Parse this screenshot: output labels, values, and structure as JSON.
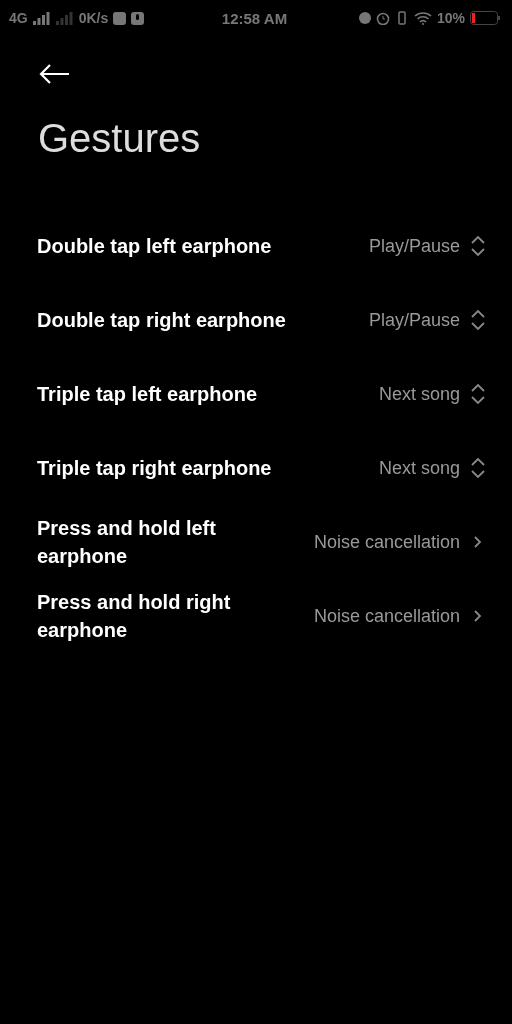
{
  "status_bar": {
    "network": "4G",
    "speed": "0K/s",
    "time": "12:58 AM",
    "battery": "10%"
  },
  "title": "Gestures",
  "rows": [
    {
      "label": "Double tap left earphone",
      "value": "Play/Pause",
      "kind": "select"
    },
    {
      "label": "Double tap right earphone",
      "value": "Play/Pause",
      "kind": "select"
    },
    {
      "label": "Triple tap left earphone",
      "value": "Next song",
      "kind": "select"
    },
    {
      "label": "Triple tap right earphone",
      "value": "Next song",
      "kind": "select"
    },
    {
      "label": "Press and hold left earphone",
      "value": "Noise cancellation",
      "kind": "link"
    },
    {
      "label": "Press and hold right earphone",
      "value": "Noise cancellation",
      "kind": "link"
    }
  ]
}
